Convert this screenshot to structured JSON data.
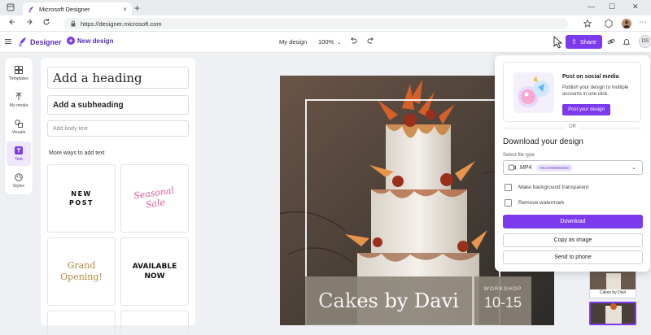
{
  "browser": {
    "tab_title": "Microsoft Designer",
    "tab_close": "×",
    "new_tab": "+",
    "url": "https://designer.microsoft.com",
    "win_min": "—",
    "win_max": "☐",
    "win_close": "✕"
  },
  "header": {
    "logo_text": "Designer",
    "new_design": "New design",
    "my_design": "My design",
    "zoom": "100%",
    "share": "Share",
    "avatar": "DS"
  },
  "rail": [
    {
      "label": "Templates",
      "icon": "templates-icon"
    },
    {
      "label": "My media",
      "icon": "my-media-icon"
    },
    {
      "label": "Visuals",
      "icon": "visuals-icon"
    },
    {
      "label": "Text",
      "icon": "text-icon"
    },
    {
      "label": "Styles",
      "icon": "styles-icon"
    }
  ],
  "text_panel": {
    "heading": "Add a heading",
    "subheading": "Add a subheading",
    "body": "Add body text",
    "more_ways": "More ways to add text",
    "cards": {
      "new_post_1": "NEW",
      "new_post_2": "POST",
      "seasonal_1": "Seasonal",
      "seasonal_2": "Sale",
      "grand_1": "Grand",
      "grand_2": "Opening!",
      "available_1": "AVAILABLE",
      "available_2": "NOW"
    }
  },
  "poster": {
    "title": "Cakes by Davi",
    "workshop_label": "WORKSHOP",
    "workshop_date": "10-15"
  },
  "thumbnails": {
    "thumb_text": "Cakes by Davi"
  },
  "share_popover": {
    "social_title": "Post on social media",
    "social_desc": "Publish your design to multiple accounts in one click.",
    "social_button": "Post your design",
    "or": "OR",
    "download_title": "Download your design",
    "file_type_label": "Select file type",
    "file_type_value": "MP4",
    "file_type_badge": "RECOMMENDED",
    "option_transparent": "Make background transparent",
    "option_watermark": "Remove watermark",
    "download_button": "Download",
    "copy_button": "Copy as image",
    "phone_button": "Send to phone"
  },
  "colors": {
    "accent": "#7c3aed",
    "brand": "#5b2bbf",
    "active_rail": "#efe7fd"
  }
}
